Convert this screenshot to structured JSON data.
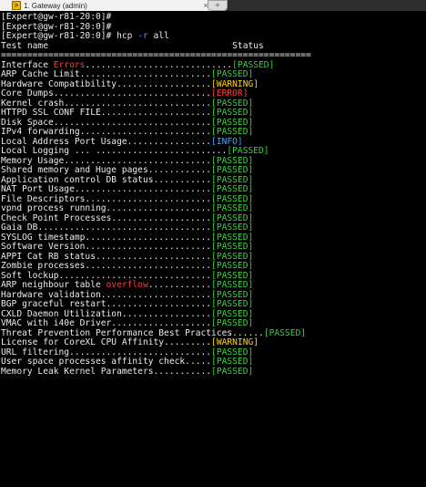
{
  "tab": {
    "title": "1. Gateway (admin)",
    "close_label": "×",
    "icon": "terminal-session-icon",
    "new_tab_label": "+",
    "new_tab_icon": "new-tab-icon"
  },
  "terminal": {
    "prompts": [
      "[Expert@gw-r81-20:0]#",
      "[Expert@gw-r81-20:0]#"
    ],
    "command": {
      "prompt": "[Expert@gw-r81-20:0]# ",
      "cmd": "hcp",
      "flag": "-r",
      "arg": "all"
    },
    "header": {
      "test_name": "Test name",
      "status": "Status",
      "separator": "==========================================================="
    },
    "results": [
      {
        "pre": "Interface ",
        "hl": "Errors",
        "hl_color": "red",
        "dots": "............................",
        "status": "[PASSED]",
        "color": "green"
      },
      {
        "pre": "ARP Cache Limit",
        "dots": ".........................",
        "status": "[PASSED]",
        "color": "green"
      },
      {
        "pre": "Hardware Compatibility",
        "dots": "..................",
        "status": "[WARNING]",
        "color": "yellow"
      },
      {
        "pre": "Core Dumps",
        "dots": "..............................",
        "status": "[ERROR]",
        "color": "red"
      },
      {
        "pre": "Kernel crash",
        "dots": "............................",
        "status": "[PASSED]",
        "color": "green"
      },
      {
        "pre": "HTTPD SSL CONF FILE",
        "dots": ".....................",
        "status": "[PASSED]",
        "color": "green"
      },
      {
        "pre": "Disk Space",
        "dots": "..............................",
        "status": "[PASSED]",
        "color": "green"
      },
      {
        "pre": "IPv4 forwarding",
        "dots": ".........................",
        "status": "[PASSED]",
        "color": "green"
      },
      {
        "pre": "Local Address Port Usage",
        "dots": "................",
        "status": "[INFO]",
        "color": "blue"
      },
      {
        "pre": "Local Logging",
        "dots": " ... .........................",
        "status": "[PASSED]",
        "color": "green"
      },
      {
        "pre": "Memory Usage",
        "dots": "............................",
        "status": "[PASSED]",
        "color": "green"
      },
      {
        "pre": "Shared memory and Huge pages",
        "dots": "............",
        "status": "[PASSED]",
        "color": "green"
      },
      {
        "pre": "Application control DB status",
        "dots": "...........",
        "status": "[PASSED]",
        "color": "green"
      },
      {
        "pre": "NAT Port Usage",
        "dots": "..........................",
        "status": "[PASSED]",
        "color": "green"
      },
      {
        "pre": "File Descriptors",
        "dots": "........................",
        "status": "[PASSED]",
        "color": "green"
      },
      {
        "pre": "vpnd process running",
        "dots": "....................",
        "status": "[PASSED]",
        "color": "green"
      },
      {
        "pre": "Check Point Processes",
        "dots": "...................",
        "status": "[PASSED]",
        "color": "green"
      },
      {
        "pre": "Gaia DB",
        "dots": ".................................",
        "status": "[PASSED]",
        "color": "green"
      },
      {
        "pre": "SYSLOG timestamp",
        "dots": "........................",
        "status": "[PASSED]",
        "color": "green"
      },
      {
        "pre": "Software Version",
        "dots": "........................",
        "status": "[PASSED]",
        "color": "green"
      },
      {
        "pre": "APPI Cat RB status",
        "dots": "......................",
        "status": "[PASSED]",
        "color": "green"
      },
      {
        "pre": "Zombie processes",
        "dots": "........................",
        "status": "[PASSED]",
        "color": "green"
      },
      {
        "pre": "Soft lockup",
        "dots": ".............................",
        "status": "[PASSED]",
        "color": "green"
      },
      {
        "pre": "ARP neighbour table ",
        "hl": "overflow",
        "hl_color": "red",
        "dots": "............",
        "status": "[PASSED]",
        "color": "green"
      },
      {
        "pre": "Hardware validation",
        "dots": ".....................",
        "status": "[PASSED]",
        "color": "green"
      },
      {
        "pre": "BGP graceful restart",
        "dots": "....................",
        "status": "[PASSED]",
        "color": "green"
      },
      {
        "pre": "CXLD Daemon Utilization",
        "dots": ".................",
        "status": "[PASSED]",
        "color": "green"
      },
      {
        "pre": "VMAC with i40e Driver",
        "dots": "...................",
        "status": "[PASSED]",
        "color": "green"
      },
      {
        "pre": "Threat Prevention Performance Best Practices",
        "dots": "......",
        "status": "[PASSED]",
        "color": "green"
      },
      {
        "pre": "License for CoreXL CPU Affinity",
        "dots": ".........",
        "status": "[WARNING]",
        "color": "yellow"
      },
      {
        "pre": "URL filtering",
        "dots": "...........................",
        "status": "[PASSED]",
        "color": "green"
      },
      {
        "pre": "User space processes affinity check",
        "dots": ".....",
        "status": "[PASSED]",
        "color": "green"
      },
      {
        "pre": "Memory Leak Kernel Parameters",
        "dots": "...........",
        "status": "[PASSED]",
        "color": "green"
      }
    ]
  }
}
